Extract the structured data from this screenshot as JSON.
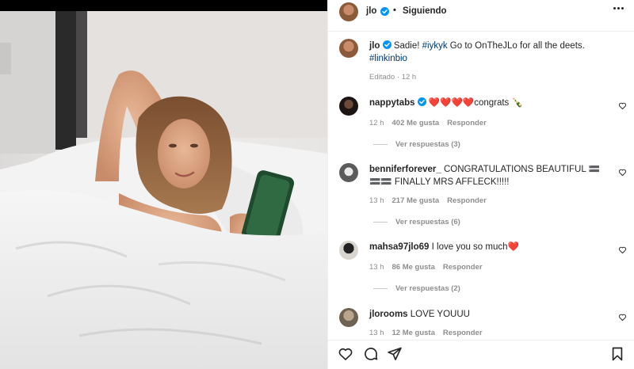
{
  "header": {
    "username": "jlo",
    "separator": "•",
    "follow_label": "Siguiendo"
  },
  "caption": {
    "username": "jlo",
    "text_1": "Sadie!",
    "hashtag_1": "#iykyk",
    "text_2": "Go to OnTheJLo for all the deets.",
    "hashtag_2": "#linkinbio",
    "edited": "Editado",
    "time": "12 h"
  },
  "comments": [
    {
      "username": "nappytabs",
      "verified": true,
      "text": "❤️❤️❤️❤️congrats 🍾",
      "time": "12 h",
      "likes": "402 Me gusta",
      "reply_label": "Responder",
      "replies": "Ver respuestas (3)"
    },
    {
      "username": "benniferforever_",
      "verified": false,
      "text": "CONGRATULATIONS BEAUTIFUL 🟰🟰🟰 FINALLY MRS AFFLECK!!!!!",
      "time": "13 h",
      "likes": "217 Me gusta",
      "reply_label": "Responder",
      "replies": "Ver respuestas (6)"
    },
    {
      "username": "mahsa97jlo69",
      "verified": false,
      "text": "I love you so much❤️",
      "time": "13 h",
      "likes": "86 Me gusta",
      "reply_label": "Responder",
      "replies": "Ver respuestas (2)"
    },
    {
      "username": "jlorooms",
      "verified": false,
      "text": "LOVE YOUUU",
      "time": "13 h",
      "likes": "12 Me gusta",
      "reply_label": "Responder",
      "replies": ""
    }
  ],
  "colors": {
    "verified_blue": "#0095f6",
    "hashtag": "#00376b",
    "muted": "#8e8e8e",
    "border": "#efefef"
  },
  "icons": [
    "verified-icon",
    "more-options-icon",
    "heart-icon",
    "comment-icon",
    "share-icon",
    "bookmark-icon"
  ]
}
